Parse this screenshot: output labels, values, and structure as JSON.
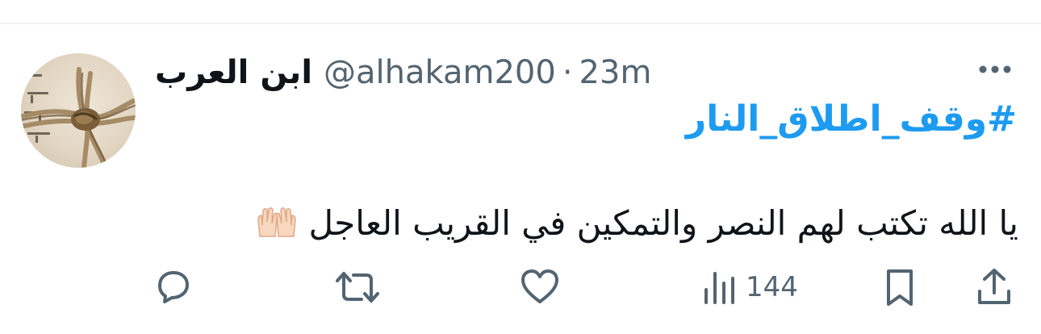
{
  "tweet": {
    "author": {
      "display_name": "ابن العرب",
      "handle": "@alhakam200",
      "avatar_icon": "avatar-rope-knot"
    },
    "separator": "·",
    "timestamp": "23m",
    "hashtag": "#وقف_اطلاق_النار",
    "text": "يا الله تكتب لهم النصر والتمكين في القريب العاجل",
    "emoji_icon": "raised-hands-emoji",
    "more_icon": "more-icon"
  },
  "actions": {
    "reply_icon": "reply-icon",
    "retweet_icon": "retweet-icon",
    "like_icon": "like-icon",
    "views_icon": "views-icon",
    "views_count": "144",
    "bookmark_icon": "bookmark-icon",
    "share_icon": "share-icon"
  },
  "colors": {
    "accent": "#1d9bf0",
    "secondary_text": "#536471",
    "primary_text": "#0f1419",
    "divider": "#eff3f4"
  }
}
